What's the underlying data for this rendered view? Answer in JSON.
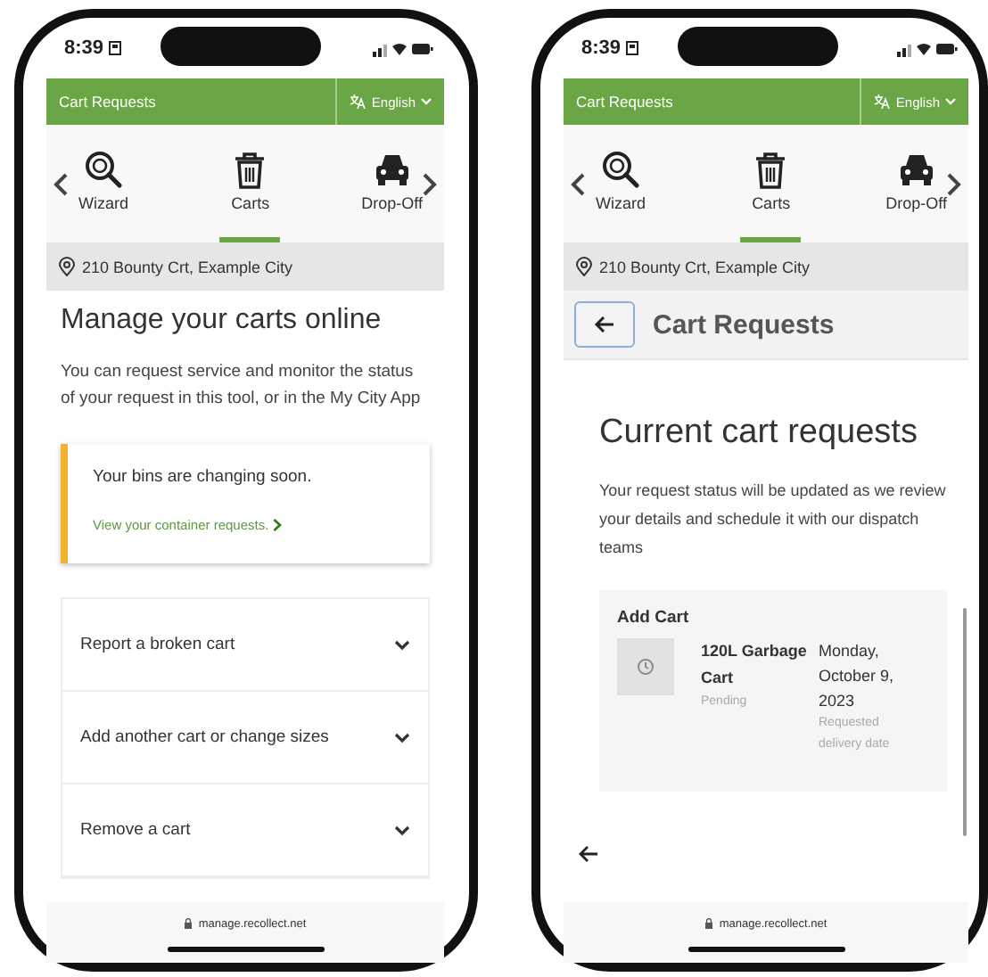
{
  "phones": [
    {
      "kind": "home",
      "time": "8:39",
      "header": {
        "title": "Cart Requests",
        "language": "English"
      },
      "nav": [
        {
          "label": "Wizard",
          "selected": false
        },
        {
          "label": "Carts",
          "selected": true
        },
        {
          "label": "Drop-Off",
          "selected": false
        }
      ],
      "address": "210 Bounty Crt, Example City",
      "heading": "Manage your carts online",
      "intro": "You can request service and monitor the status of your request in this tool, or in the My City App",
      "notice": {
        "title": "Your bins are changing soon.",
        "link": "View your container requests."
      },
      "accordion": [
        {
          "label": "Report a broken cart",
          "expanded": false
        },
        {
          "label": "Add another cart or change sizes",
          "expanded": false
        },
        {
          "label": "Remove a cart",
          "expanded": false
        }
      ],
      "url": "manage.recollect.net"
    },
    {
      "kind": "requests",
      "time": "8:39",
      "header": {
        "title": "Cart Requests",
        "language": "English"
      },
      "nav": [
        {
          "label": "Wizard",
          "selected": false
        },
        {
          "label": "Carts",
          "selected": true
        },
        {
          "label": "Drop-Off",
          "selected": false
        }
      ],
      "address": "210 Bounty Crt, Example City",
      "page_title": "Cart Requests",
      "heading": "Current cart requests",
      "intro": "Your request status will be updated as we review your details and schedule it with our dispatch teams",
      "request": {
        "section": "Add Cart",
        "item": "120L Garbage Cart",
        "status": "Pending",
        "date": "Monday, October 9, 2023",
        "date_label": "Requested delivery date"
      },
      "url": "manage.recollect.net"
    }
  ]
}
